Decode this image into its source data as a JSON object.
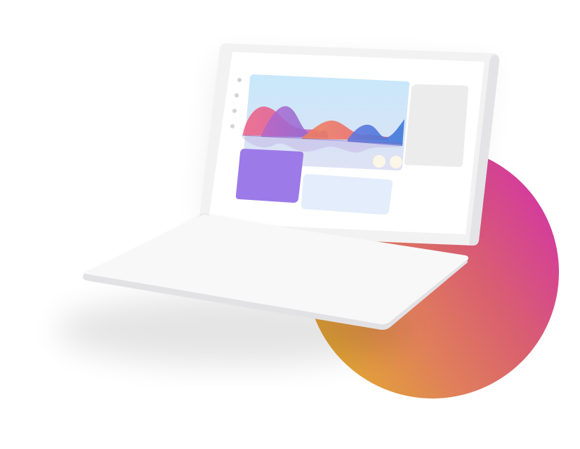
{
  "illustration": {
    "colors": {
      "background": "#ffffff",
      "laptop_body": "#f6f6f7",
      "laptop_screen_bezel": "#efeff0",
      "screen": "#ffffff",
      "chart_panel_top": "#c9e8fb",
      "chart_panel_bottom": "#dde4f5",
      "side_panel": "#ececec",
      "purple_card": "#9d7be9",
      "light_card": "#e4eefb",
      "circle_gradient": [
        "#e2a634",
        "#d9715f",
        "#d8598c",
        "#d43d9a"
      ],
      "wave_colors": [
        "#f0547f",
        "#9e5bd0",
        "#f26a4b",
        "#3b6fd8"
      ],
      "dots": "#cfcfd4"
    },
    "icons": [
      "menu-dot-icon",
      "menu-dot-icon",
      "menu-dot-icon",
      "menu-dot-icon",
      "toggle-dot-icon",
      "toggle-dot-icon"
    ]
  }
}
